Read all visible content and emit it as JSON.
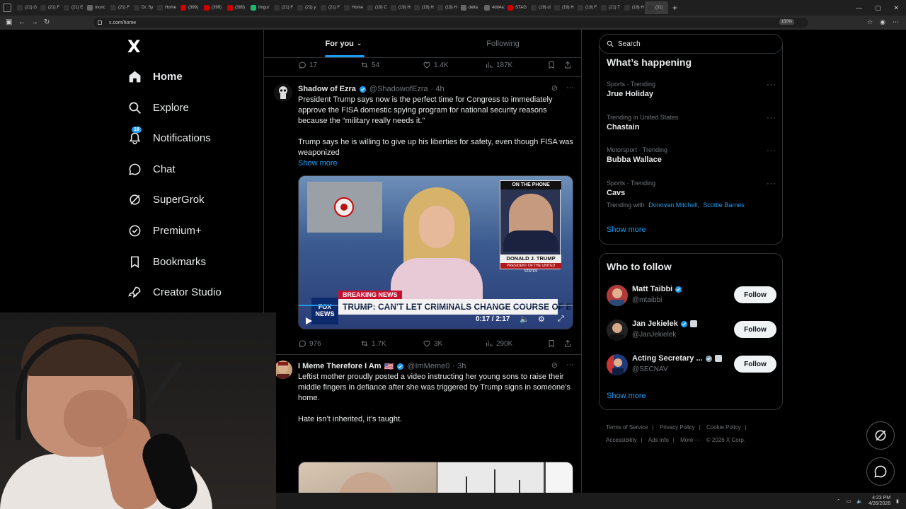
{
  "browser": {
    "tabs": [
      {
        "label": "(21) G",
        "icon": "x-icon",
        "color": "#333"
      },
      {
        "label": "(21) F",
        "icon": "x-icon",
        "color": "#333"
      },
      {
        "label": "(21) E",
        "icon": "x-icon",
        "color": "#333"
      },
      {
        "label": "munc",
        "icon": "globe-icon",
        "color": "#666"
      },
      {
        "label": "(21) F",
        "icon": "x-icon",
        "color": "#333"
      },
      {
        "label": "Dr. Sy",
        "icon": "x-icon",
        "color": "#333"
      },
      {
        "label": "Home",
        "icon": "x-icon",
        "color": "#333"
      },
      {
        "label": "(399)",
        "icon": "youtube-icon",
        "color": "#c00"
      },
      {
        "label": "(399)",
        "icon": "youtube-icon",
        "color": "#c00"
      },
      {
        "label": "(399)",
        "icon": "youtube-icon",
        "color": "#c00"
      },
      {
        "label": "Imgur",
        "icon": "imgur-icon",
        "color": "#1bb76e"
      },
      {
        "label": "(21) F",
        "icon": "x-icon",
        "color": "#333"
      },
      {
        "label": "(21) y",
        "icon": "x-icon",
        "color": "#333"
      },
      {
        "label": "(21) F",
        "icon": "x-icon",
        "color": "#333"
      },
      {
        "label": "Home",
        "icon": "x-icon",
        "color": "#333"
      },
      {
        "label": "(19) C",
        "icon": "x-icon",
        "color": "#333"
      },
      {
        "label": "(19) H",
        "icon": "x-icon",
        "color": "#333"
      },
      {
        "label": "(19) H",
        "icon": "x-icon",
        "color": "#333"
      },
      {
        "label": "(19) H",
        "icon": "x-icon",
        "color": "#333"
      },
      {
        "label": "delta",
        "icon": "globe-icon",
        "color": "#666"
      },
      {
        "label": "4dd4a14",
        "icon": "globe-icon",
        "color": "#666"
      },
      {
        "label": "STAG",
        "icon": "youtube-icon",
        "color": "#c00"
      },
      {
        "label": "(19) cl",
        "icon": "x-icon",
        "color": "#333"
      },
      {
        "label": "(19) H",
        "icon": "x-icon",
        "color": "#333"
      },
      {
        "label": "(19) F",
        "icon": "x-icon",
        "color": "#333"
      },
      {
        "label": "(21) T",
        "icon": "x-icon",
        "color": "#333"
      },
      {
        "label": "(18) H",
        "icon": "x-icon",
        "color": "#333"
      },
      {
        "label": "(31)",
        "icon": "x-icon",
        "color": "#333",
        "active": true
      }
    ],
    "new_tab": "+",
    "url": "x.com/home",
    "zoom": "150%"
  },
  "nav": {
    "logo": "X",
    "items": [
      {
        "key": "home",
        "label": "Home",
        "icon": "home-icon"
      },
      {
        "key": "explore",
        "label": "Explore",
        "icon": "search-icon"
      },
      {
        "key": "notifications",
        "label": "Notifications",
        "icon": "bell-icon",
        "badge": "18"
      },
      {
        "key": "chat",
        "label": "Chat",
        "icon": "chat-icon"
      },
      {
        "key": "supergrok",
        "label": "SuperGrok",
        "icon": "grok-icon"
      },
      {
        "key": "premium",
        "label": "Premium+",
        "icon": "verified-badge-icon"
      },
      {
        "key": "bookmarks",
        "label": "Bookmarks",
        "icon": "bookmark-icon"
      },
      {
        "key": "creator",
        "label": "Creator Studio",
        "icon": "rocket-icon"
      }
    ]
  },
  "feed": {
    "tabs": [
      {
        "label": "For you",
        "active": true
      },
      {
        "label": "Following",
        "active": false
      }
    ],
    "top_actions": {
      "replies": "17",
      "reposts": "54",
      "likes": "1.4K",
      "views": "187K"
    },
    "posts": [
      {
        "name": "Shadow of Ezra",
        "handle": "@ShadowofEzra",
        "time": "· 4h",
        "paragraphs": [
          "President Trump says now is the perfect time for Congress to immediately approve the FISA domestic spying program for national security reasons because the “military really needs it.”",
          "Trump says he is willing to give up his liberties for safety, even though FISA was weaponized"
        ],
        "show_more": "Show more",
        "video": {
          "phone_label": "ON THE PHONE",
          "phone_name": "DONALD J. TRUMP",
          "phone_sub": "PRESIDENT OF THE UNITED STATES",
          "breaking": "BREAKING NEWS",
          "chyron": "TRUMP: CAN'T LET CRIMINALS CHANGE COURSE OF EVENTS",
          "network": "FOX NEWS",
          "time": "0:17 / 2:17",
          "progress": 0.125
        },
        "actions": {
          "replies": "976",
          "reposts": "1.7K",
          "likes": "3K",
          "views": "290K"
        }
      },
      {
        "name": "I Meme Therefore I Am",
        "flag": "🇺🇸",
        "handle": "@ImMeme0",
        "time": "· 3h",
        "paragraphs": [
          "Leftist mother proudly posted a video instructing her young sons to raise their middle fingers in defiance after she was triggered by Trump signs in someone’s home.",
          "Hate isn’t inherited, it’s taught."
        ]
      }
    ]
  },
  "sidebar": {
    "search_placeholder": "Search",
    "happening": {
      "title": "What’s happening",
      "trends": [
        {
          "meta": "Sports · Trending",
          "name": "Jrue Holiday"
        },
        {
          "meta": "Trending in United States",
          "name": "Chastain"
        },
        {
          "meta": "Motorsport · Trending",
          "name": "Bubba Wallace"
        },
        {
          "meta": "Sports · Trending",
          "name": "Cavs",
          "with_label": "Trending with",
          "with": [
            "Donovan Mitchell",
            "Scottie Barnes"
          ]
        }
      ],
      "show_more": "Show more"
    },
    "who_to_follow": {
      "title": "Who to follow",
      "accounts": [
        {
          "name": "Matt Taibbi",
          "handle": "@mtaibbi",
          "button": "Follow"
        },
        {
          "name": "Jan Jekielek",
          "handle": "@JanJekielek",
          "button": "Follow"
        },
        {
          "name": "Acting Secretary ...",
          "handle": "@SECNAV",
          "button": "Follow"
        }
      ],
      "show_more": "Show more"
    },
    "footer": {
      "links": [
        "Terms of Service",
        "Privacy Policy",
        "Cookie Policy",
        "Accessibility",
        "Ads info",
        "More ···"
      ],
      "copyright": "© 2026 X Corp."
    }
  },
  "taskbar": {
    "time": "4:23 PM",
    "date": "4/26/2026"
  },
  "colors": {
    "accent": "#1d9bf0",
    "bg": "#000000",
    "border": "#2f3336",
    "muted": "#71767b"
  }
}
